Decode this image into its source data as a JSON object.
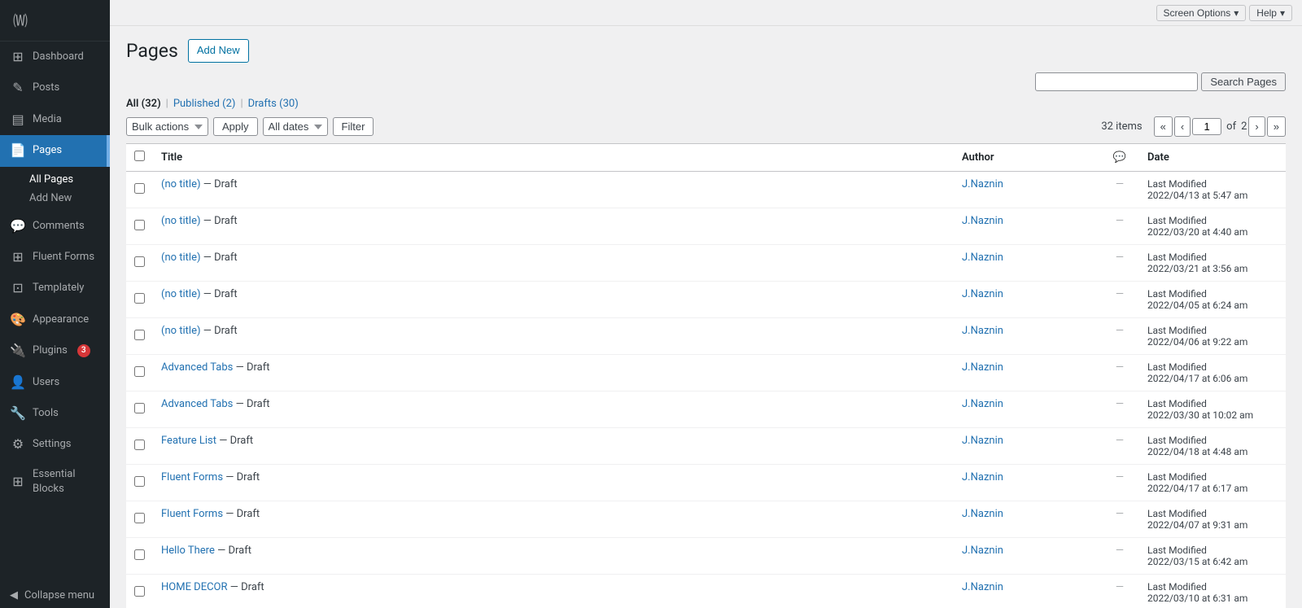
{
  "topbar": {
    "screen_options": "Screen Options",
    "help": "Help"
  },
  "sidebar": {
    "logo": "W",
    "items": [
      {
        "id": "dashboard",
        "label": "Dashboard",
        "icon": "⊞"
      },
      {
        "id": "posts",
        "label": "Posts",
        "icon": "✎"
      },
      {
        "id": "media",
        "label": "Media",
        "icon": "🖼"
      },
      {
        "id": "pages",
        "label": "Pages",
        "icon": "📄",
        "active": true
      },
      {
        "id": "comments",
        "label": "Comments",
        "icon": "💬"
      },
      {
        "id": "fluent-forms",
        "label": "Fluent Forms",
        "icon": "⊞"
      },
      {
        "id": "templately",
        "label": "Templately",
        "icon": "⊡"
      },
      {
        "id": "appearance",
        "label": "Appearance",
        "icon": "🎨"
      },
      {
        "id": "plugins",
        "label": "Plugins",
        "icon": "🔌",
        "badge": "3"
      },
      {
        "id": "users",
        "label": "Users",
        "icon": "👤"
      },
      {
        "id": "tools",
        "label": "Tools",
        "icon": "🔧"
      },
      {
        "id": "settings",
        "label": "Settings",
        "icon": "⚙"
      },
      {
        "id": "essential-blocks",
        "label": "Essential Blocks",
        "icon": "⊞"
      }
    ],
    "pages_sub": [
      {
        "id": "all-pages",
        "label": "All Pages",
        "active": true
      },
      {
        "id": "add-new",
        "label": "Add New"
      }
    ],
    "collapse": "Collapse menu"
  },
  "header": {
    "title": "Pages",
    "add_new": "Add New"
  },
  "filter_nav": {
    "all": "All",
    "all_count": "32",
    "published": "Published",
    "published_count": "2",
    "drafts": "Drafts",
    "drafts_count": "30"
  },
  "controls": {
    "bulk_actions": "Bulk actions",
    "apply": "Apply",
    "all_dates": "All dates",
    "filter": "Filter",
    "items_count": "32 items",
    "page_current": "1",
    "page_total": "2",
    "search_placeholder": "",
    "search_btn": "Search Pages"
  },
  "table": {
    "col_title": "Title",
    "col_author": "Author",
    "col_date": "Date",
    "rows": [
      {
        "title": "(no title)",
        "status": "Draft",
        "author": "J.Naznin",
        "date_label": "Last Modified",
        "date_value": "2022/04/13 at 5:47 am"
      },
      {
        "title": "(no title)",
        "status": "Draft",
        "author": "J.Naznin",
        "date_label": "Last Modified",
        "date_value": "2022/03/20 at 4:40 am"
      },
      {
        "title": "(no title)",
        "status": "Draft",
        "author": "J.Naznin",
        "date_label": "Last Modified",
        "date_value": "2022/03/21 at 3:56 am"
      },
      {
        "title": "(no title)",
        "status": "Draft",
        "author": "J.Naznin",
        "date_label": "Last Modified",
        "date_value": "2022/04/05 at 6:24 am"
      },
      {
        "title": "(no title)",
        "status": "Draft",
        "author": "J.Naznin",
        "date_label": "Last Modified",
        "date_value": "2022/04/06 at 9:22 am"
      },
      {
        "title": "Advanced Tabs",
        "status": "Draft",
        "author": "J.Naznin",
        "date_label": "Last Modified",
        "date_value": "2022/04/17 at 6:06 am"
      },
      {
        "title": "Advanced Tabs",
        "status": "Draft",
        "author": "J.Naznin",
        "date_label": "Last Modified",
        "date_value": "2022/03/30 at 10:02 am"
      },
      {
        "title": "Feature List",
        "status": "Draft",
        "author": "J.Naznin",
        "date_label": "Last Modified",
        "date_value": "2022/04/18 at 4:48 am"
      },
      {
        "title": "Fluent Forms",
        "status": "Draft",
        "author": "J.Naznin",
        "date_label": "Last Modified",
        "date_value": "2022/04/17 at 6:17 am"
      },
      {
        "title": "Fluent Forms",
        "status": "Draft",
        "author": "J.Naznin",
        "date_label": "Last Modified",
        "date_value": "2022/04/07 at 9:31 am"
      },
      {
        "title": "Hello There",
        "status": "Draft",
        "author": "J.Naznin",
        "date_label": "Last Modified",
        "date_value": "2022/03/15 at 6:42 am"
      },
      {
        "title": "HOME DECOR",
        "status": "Draft",
        "author": "J.Naznin",
        "date_label": "Last Modified",
        "date_value": "2022/03/10 at 6:31 am"
      }
    ]
  }
}
